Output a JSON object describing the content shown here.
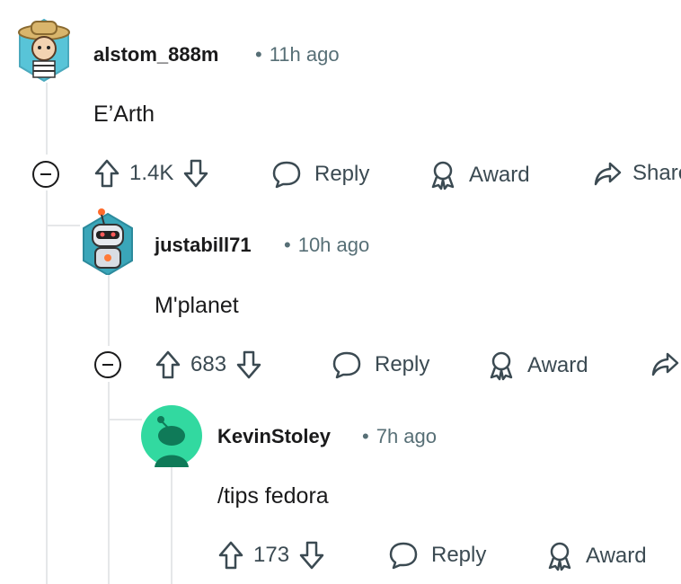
{
  "comments": [
    {
      "username": "alstom_888m",
      "time": "11h ago",
      "body": "E’Arth",
      "score": "1.4K",
      "reply_label": "Reply",
      "award_label": "Award",
      "share_label": "Share"
    },
    {
      "username": "justabill71",
      "time": "10h ago",
      "body": "M'planet",
      "score": "683",
      "reply_label": "Reply",
      "award_label": "Award"
    },
    {
      "username": "KevinStoley",
      "time": "7h ago",
      "body": "/tips fedora",
      "score": "173",
      "reply_label": "Reply",
      "award_label": "Award"
    }
  ],
  "colors": {
    "text": "#1a1a1b",
    "meta": "#576f76",
    "thread_line": "#e5e7e9",
    "snoo_bg": "#32d9a0"
  },
  "icons": [
    "upvote-icon",
    "downvote-icon",
    "reply-bubble-icon",
    "award-icon",
    "share-arrow-icon",
    "collapse-icon"
  ]
}
